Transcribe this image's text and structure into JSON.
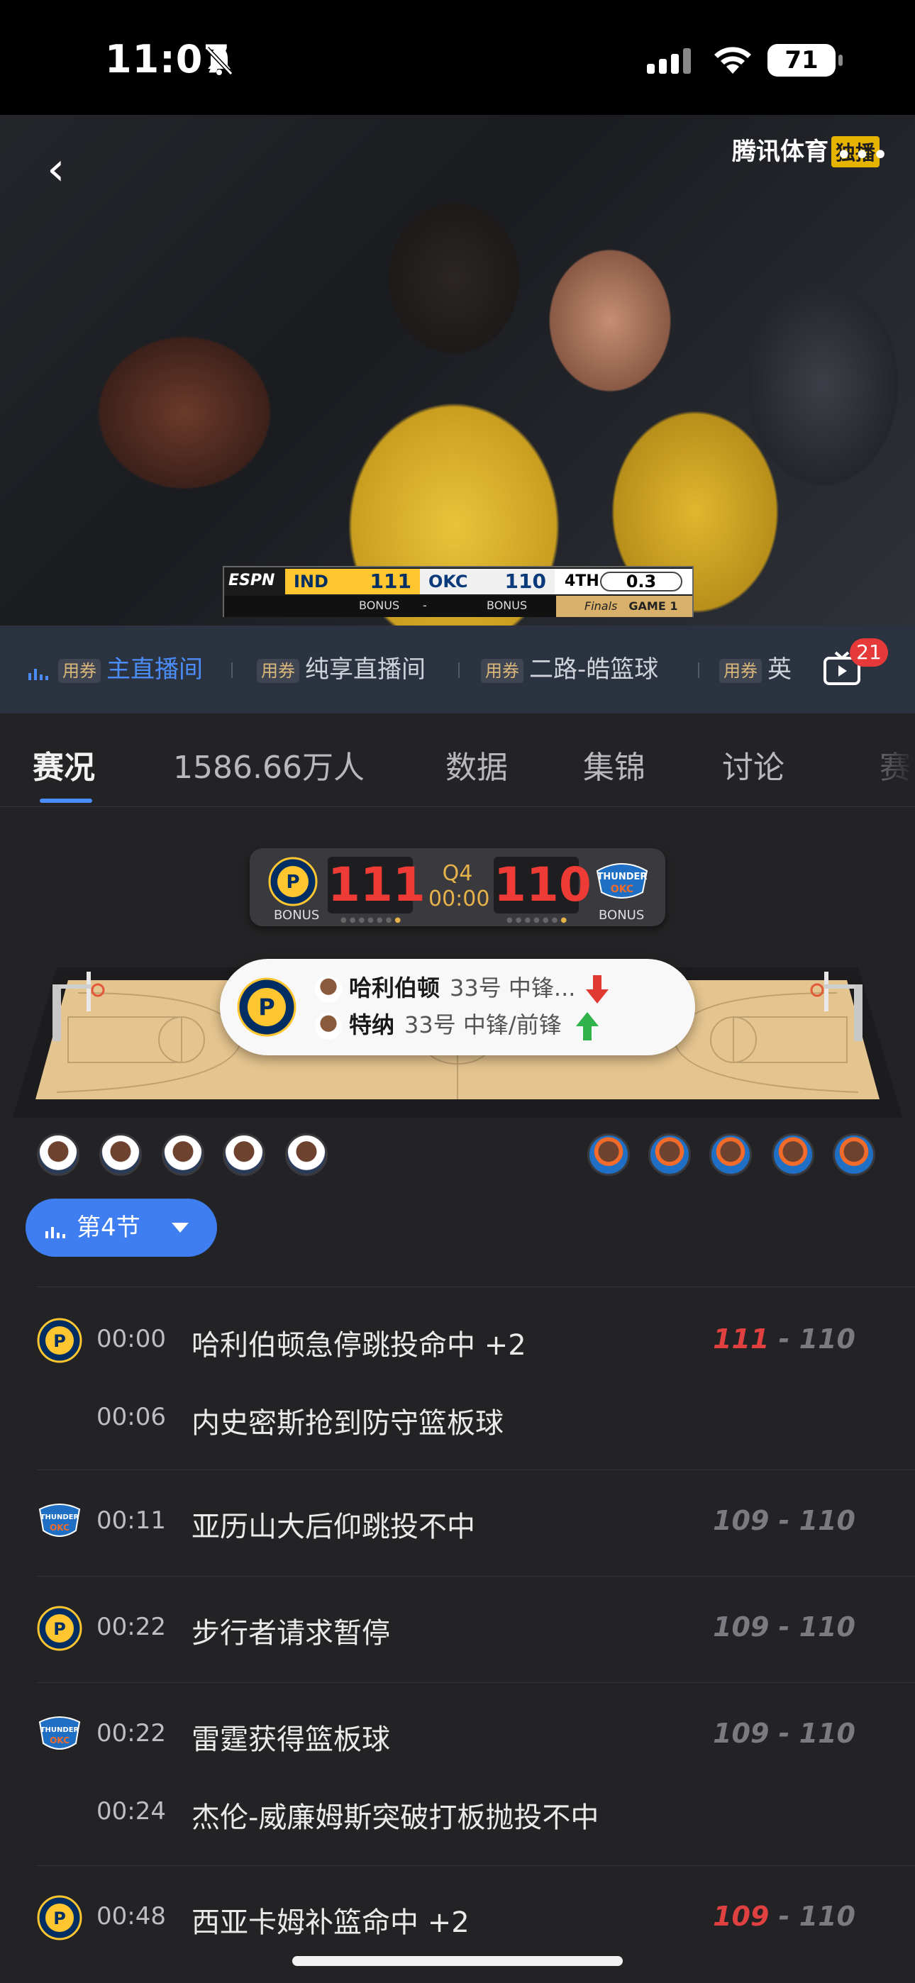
{
  "status_bar": {
    "time": "11:07",
    "battery": "71"
  },
  "video": {
    "logo": "腾讯体育",
    "exclusive_badge": "独播"
  },
  "scorebug": {
    "network": "ESPN",
    "home_abbr": "IND",
    "home_score": "111",
    "away_abbr": "OKC",
    "away_score": "110",
    "quarter": "4TH",
    "clock": "0.3",
    "bonus_left": "BONUS",
    "separator": "-",
    "bonus_right": "BONUS",
    "finals": "Finals",
    "game": "GAME 1"
  },
  "channels": {
    "items": [
      {
        "tag": "用券",
        "label": "主直播间",
        "active": true
      },
      {
        "tag": "用券",
        "label": "纯享直播间",
        "active": false
      },
      {
        "tag": "用券",
        "label": "二路-皓篮球",
        "active": false
      },
      {
        "tag": "用券",
        "label": "英",
        "active": false
      }
    ],
    "badge_count": "21"
  },
  "tabs": {
    "items": [
      "赛况",
      "1586.66万人",
      "数据",
      "集锦",
      "讨论",
      "赛"
    ],
    "active": 0
  },
  "mini_score": {
    "home_score": "111",
    "away_score": "110",
    "quarter": "Q4",
    "clock": "00:00",
    "home_bonus": "BONUS",
    "away_bonus": "BONUS",
    "home_logo_text": "INDIANA PACERS",
    "away_logo_text": "THUNDER"
  },
  "substitution": {
    "out": {
      "name": "哈利伯顿",
      "detail": "33号 中锋..."
    },
    "in": {
      "name": "特纳",
      "detail": "33号 中锋/前锋"
    }
  },
  "quarter_selector": {
    "label": "第4节"
  },
  "events": [
    {
      "team": "IND",
      "time": "00:00",
      "text": "哈利伯顿急停跳投命中 +2",
      "score_home": "111",
      "score_sep": " - ",
      "score_away": "110",
      "highlight": "home"
    },
    {
      "team": "",
      "time": "00:06",
      "text": "内史密斯抢到防守篮板球",
      "score_home": "",
      "score_sep": "",
      "score_away": "",
      "highlight": ""
    },
    {
      "team": "OKC",
      "time": "00:11",
      "text": "亚历山大后仰跳投不中",
      "score_home": "109",
      "score_sep": " - ",
      "score_away": "110",
      "highlight": ""
    },
    {
      "team": "IND",
      "time": "00:22",
      "text": "步行者请求暂停",
      "score_home": "109",
      "score_sep": " - ",
      "score_away": "110",
      "highlight": ""
    },
    {
      "team": "OKC",
      "time": "00:22",
      "text": "雷霆获得篮板球",
      "score_home": "109",
      "score_sep": " - ",
      "score_away": "110",
      "highlight": ""
    },
    {
      "team": "",
      "time": "00:24",
      "text": "杰伦-威廉姆斯突破打板抛投不中",
      "score_home": "",
      "score_sep": "",
      "score_away": "",
      "highlight": ""
    },
    {
      "team": "IND",
      "time": "00:48",
      "text": "西亚卡姆补篮命中 +2",
      "score_home": "109",
      "score_sep": " - ",
      "score_away": "110",
      "highlight": "home"
    }
  ],
  "colors": {
    "accent_blue": "#4b8df8",
    "score_red": "#ee3b36",
    "pacers_gold": "#ffc630",
    "pacers_navy": "#002d62",
    "thunder_blue": "#1f6fc4",
    "thunder_orange": "#f26b2a"
  }
}
